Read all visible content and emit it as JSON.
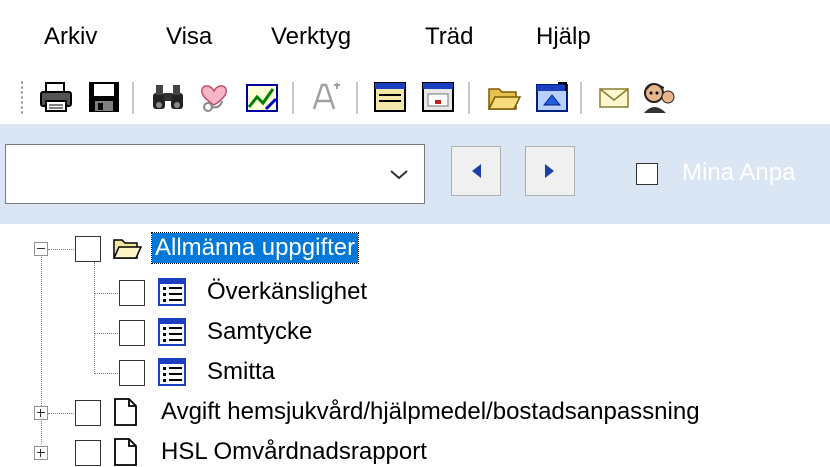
{
  "menu": [
    "Arkiv",
    "Visa",
    "Verktyg",
    "Träd",
    "Hjälp"
  ],
  "toolbar": {
    "icons": [
      "print-icon",
      "save-icon",
      "binoculars-icon",
      "heart-stethoscope-icon",
      "chart-edit-icon",
      "text-format-icon",
      "window-icon",
      "form-window-icon",
      "open-folder-icon",
      "window-refresh-icon",
      "mail-icon",
      "person-icon"
    ]
  },
  "nav": {
    "combo_value": "",
    "mina_label": "Mina Anpa"
  },
  "tree": {
    "items": [
      {
        "label": "Allmänna uppgifter",
        "type": "folder-open",
        "selected": true
      },
      {
        "label": "Överkänslighet",
        "type": "form"
      },
      {
        "label": "Samtycke",
        "type": "form"
      },
      {
        "label": "Smitta",
        "type": "form"
      },
      {
        "label": "Avgift hemsjukvård/hjälpmedel/bostadsanpassning",
        "type": "document"
      },
      {
        "label": "HSL Omvårdnadsrapport",
        "type": "document"
      }
    ]
  },
  "colors": {
    "navbar_bg": "#dae6f3",
    "selection": "#0078d7"
  }
}
